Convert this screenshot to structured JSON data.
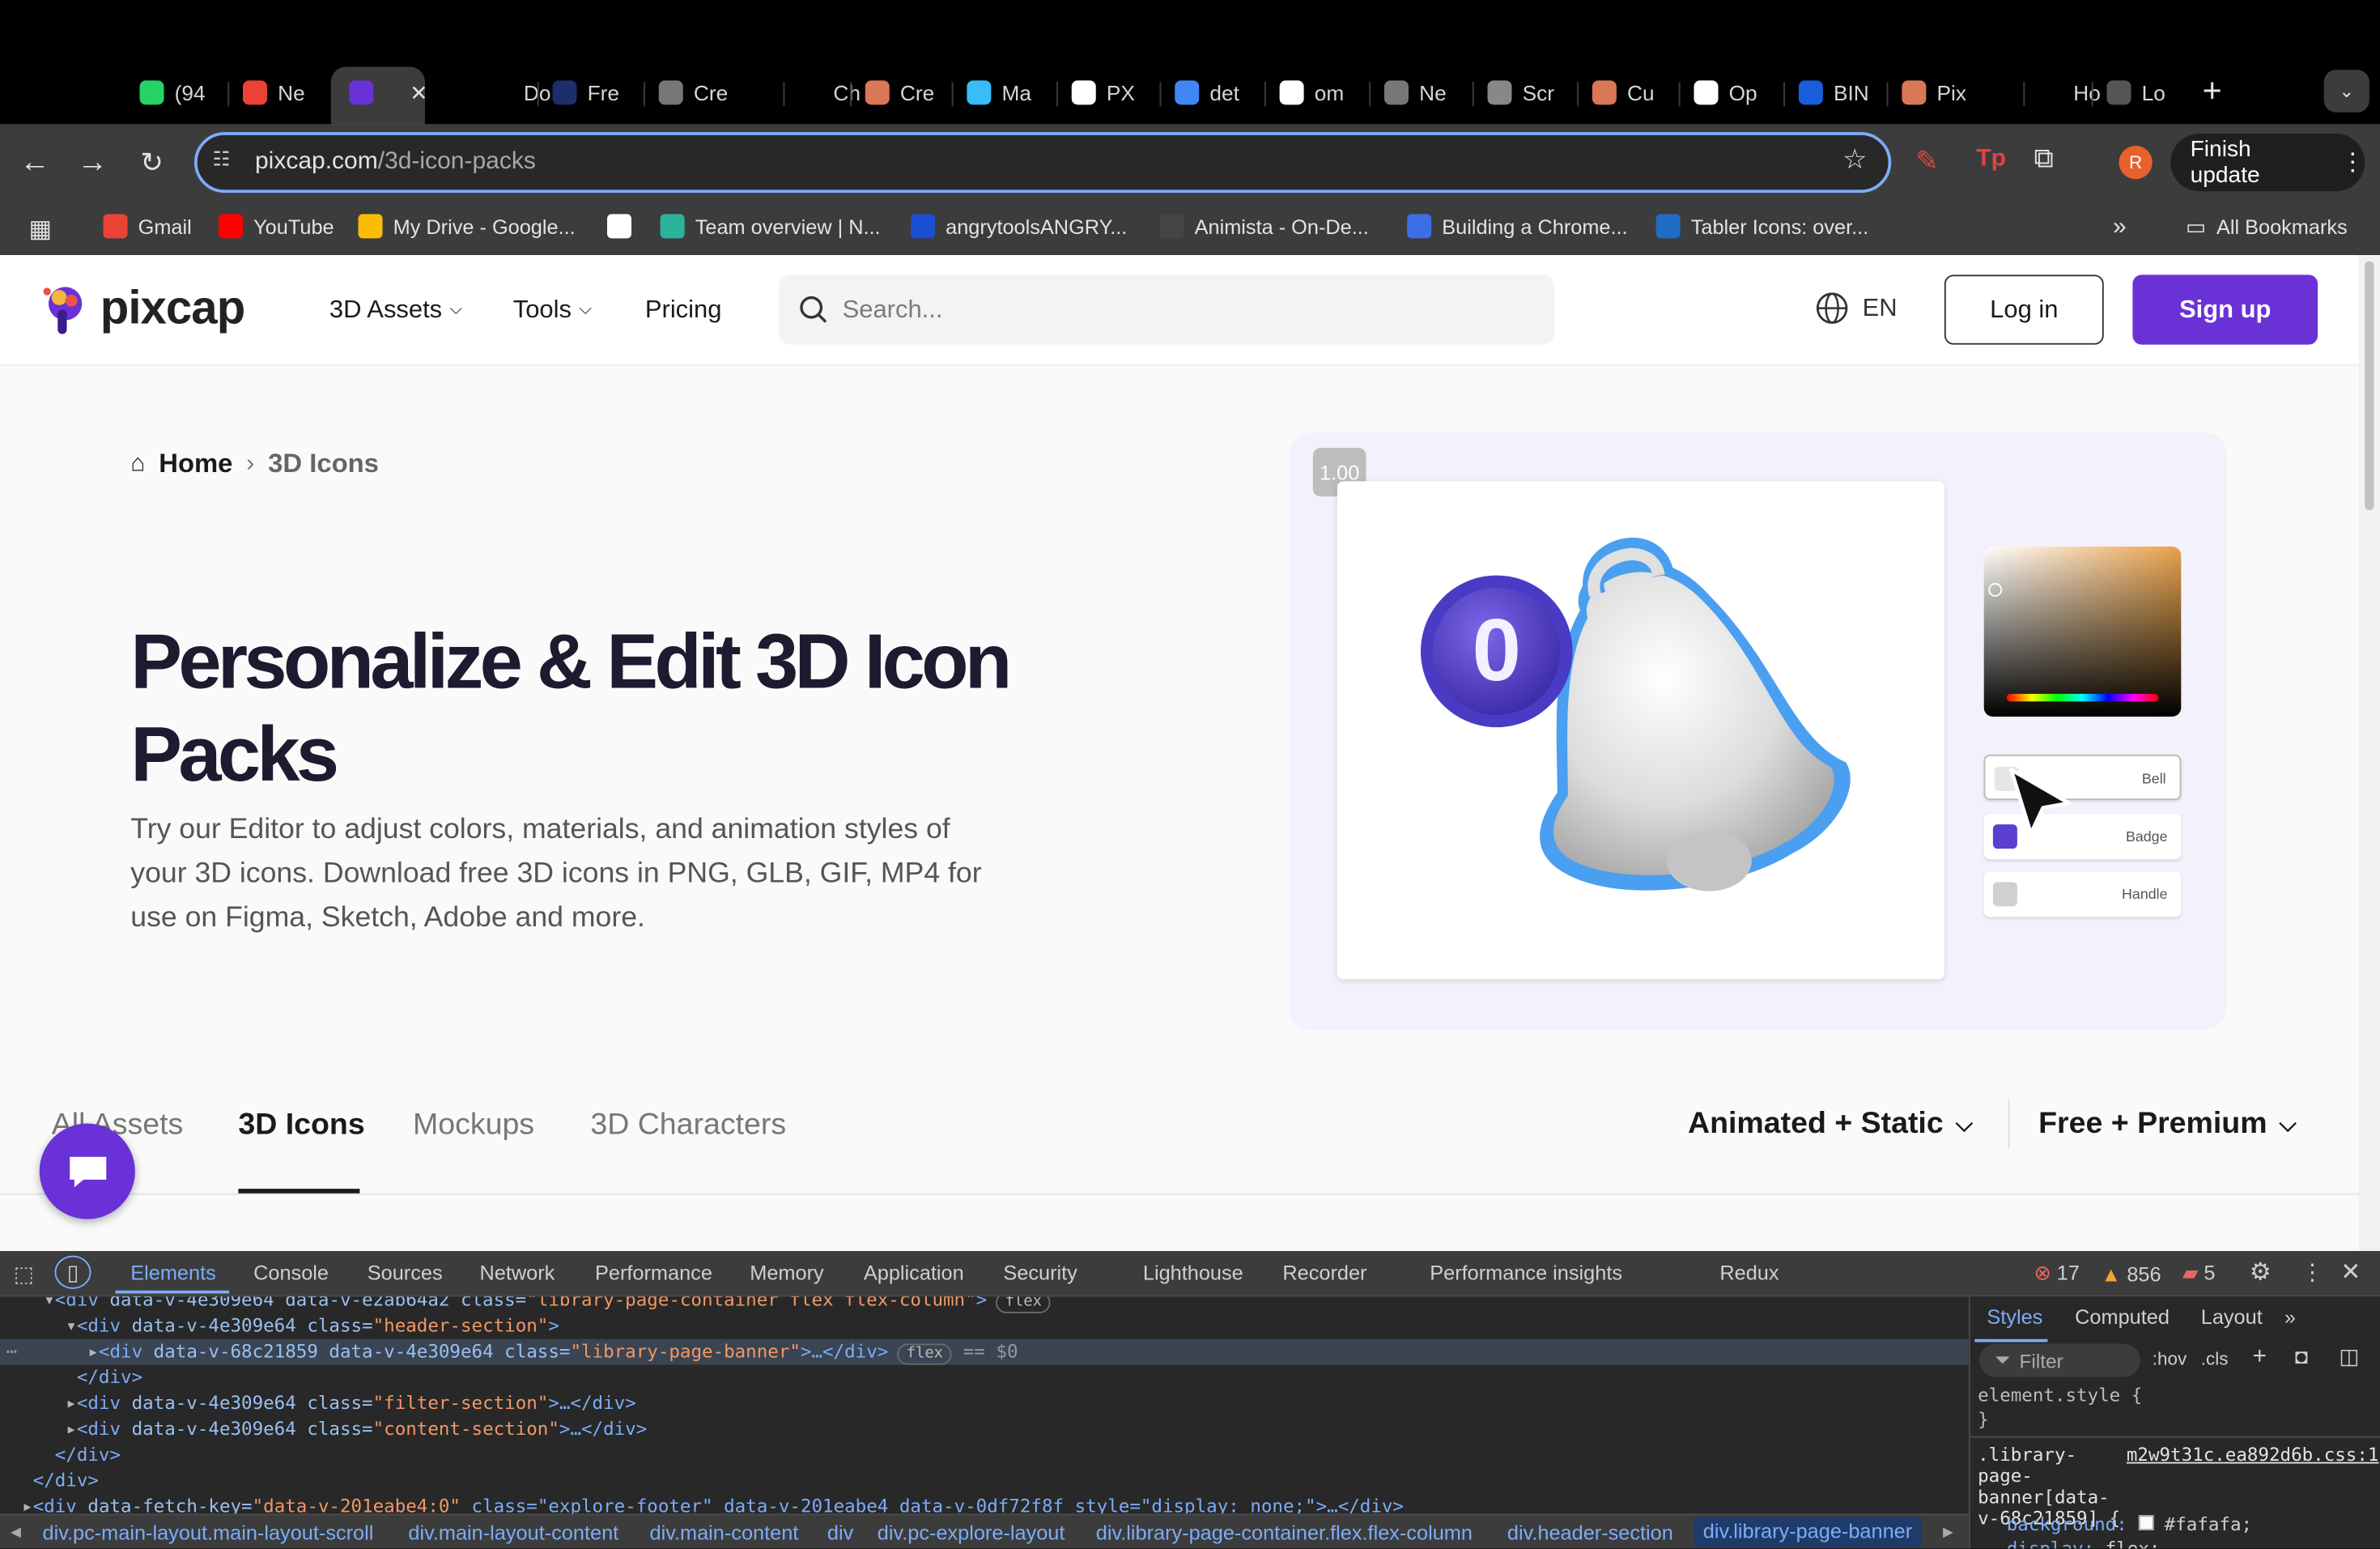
{
  "browser": {
    "tabs": [
      {
        "label": "(94",
        "icon": "whatsapp-icon",
        "color": "#25d366"
      },
      {
        "label": "Ne",
        "icon": "gmail-icon",
        "color": "#ea4335"
      },
      {
        "label": "",
        "icon": "pixcap-icon",
        "color": "#6a32d6",
        "active": true
      },
      {
        "label": "Do",
        "icon": "doc-icon",
        "color": "#000000"
      },
      {
        "label": "Fre",
        "icon": "mgl-icon",
        "color": "#1c2e6b"
      },
      {
        "label": "Cre",
        "icon": "openai-icon",
        "color": "#777777"
      },
      {
        "label": "Ch",
        "icon": "chatgpt-icon",
        "color": "#000000"
      },
      {
        "label": "Cre",
        "icon": "claude-icon",
        "color": "#d97757"
      },
      {
        "label": "Ma",
        "icon": "tailwind-icon",
        "color": "#38bdf8"
      },
      {
        "label": "PX",
        "icon": "px-icon",
        "color": "#ffffff"
      },
      {
        "label": "det",
        "icon": "google-icon",
        "color": "#4285f4"
      },
      {
        "label": "om",
        "icon": "github-icon",
        "color": "#ffffff"
      },
      {
        "label": "Ne",
        "icon": "openai-icon",
        "color": "#777777"
      },
      {
        "label": "Scr",
        "icon": "globe-icon",
        "color": "#888888"
      },
      {
        "label": "Cu",
        "icon": "claude-icon",
        "color": "#d97757"
      },
      {
        "label": "Op",
        "icon": "op-icon",
        "color": "#ffffff"
      },
      {
        "label": "BIN",
        "icon": "bitwarden-icon",
        "color": "#175ddc"
      },
      {
        "label": "Pix",
        "icon": "claude-icon",
        "color": "#d97757"
      },
      {
        "label": "Ho",
        "icon": "blank-icon",
        "color": "#000000"
      },
      {
        "label": "Lo",
        "icon": "cloud-icon",
        "color": "#555555"
      }
    ],
    "url_host": "pixcap.com",
    "url_path": "/3d-icon-packs",
    "profile_initial": "R",
    "finish_update": "Finish update",
    "bookmarks": [
      {
        "label": "Gmail",
        "icon": "gmail-icon",
        "color": "#ea4335"
      },
      {
        "label": "YouTube",
        "icon": "youtube-icon",
        "color": "#ff0000"
      },
      {
        "label": "My Drive - Google...",
        "icon": "drive-icon",
        "color": "#fbbc04"
      },
      {
        "label": "",
        "icon": "github-icon",
        "color": "#ffffff"
      },
      {
        "label": "Team overview | N...",
        "icon": "diamond-icon",
        "color": "#2bb39b"
      },
      {
        "label": "angrytoolsANGRY...",
        "icon": "angrytools-icon",
        "color": "#1a4fd1"
      },
      {
        "label": "Animista - On-De...",
        "icon": "animista-icon",
        "color": "#444444"
      },
      {
        "label": "Building a Chrome...",
        "icon": "co-icon",
        "color": "#3b6ee6"
      },
      {
        "label": "Tabler Icons: over...",
        "icon": "tabler-icon",
        "color": "#206bc4"
      }
    ],
    "all_bookmarks": "All Bookmarks"
  },
  "site": {
    "logo": "pixcap",
    "nav": {
      "assets": "3D Assets",
      "tools": "Tools",
      "pricing": "Pricing"
    },
    "search_placeholder": "Search...",
    "lang": "EN",
    "login": "Log in",
    "signup": "Sign up"
  },
  "breadcrumb": {
    "home": "Home",
    "current": "3D Icons"
  },
  "hero": {
    "title": "Personalize & Edit 3D Icon Packs",
    "subtitle": "Try our Editor to adjust colors, materials, and animation styles of your 3D icons. Download free 3D icons in PNG, GLB, GIF, MP4 for use on Figma, Sketch, Adobe and more."
  },
  "preview": {
    "zoom": "1.00",
    "badge_number": "0",
    "layers": [
      {
        "name": "Bell",
        "color": "#e6e6e6"
      },
      {
        "name": "Badge",
        "color": "#5b3fd1"
      },
      {
        "name": "Handle",
        "color": "#d0d0d0"
      }
    ]
  },
  "category_tabs": [
    {
      "label": "All Assets",
      "active": false
    },
    {
      "label": "3D Icons",
      "active": true
    },
    {
      "label": "Mockups",
      "active": false
    },
    {
      "label": "3D Characters",
      "active": false
    }
  ],
  "filters": {
    "animation": "Animated + Static",
    "price": "Free + Premium"
  },
  "devtools": {
    "tabs": [
      "Elements",
      "Console",
      "Sources",
      "Network",
      "Performance",
      "Memory",
      "Application",
      "Security",
      "Lighthouse",
      "Recorder",
      "Performance insights",
      "Redux"
    ],
    "errors": "17",
    "warnings": "856",
    "issues": "5",
    "code_lines": [
      {
        "indent": "    ▾",
        "tag": "<div",
        "attrs": " data-v-4e309e64 data-v-e2ab64a2 class=",
        "val": "\"library-page-container flex flex-column\"",
        "tail": ">",
        "badge": "flex"
      },
      {
        "indent": "      ▾",
        "tag": "<div",
        "attrs": " data-v-4e309e64 class=",
        "val": "\"header-section\"",
        "tail": ">",
        "badge": ""
      },
      {
        "indent": "        ▸",
        "tag": "<div",
        "attrs": " data-v-68c21859 data-v-4e309e64 class=",
        "val": "\"library-page-banner\"",
        "tail": ">…</div>",
        "badge": "flex",
        "selected": true,
        "suffix": " == $0"
      },
      {
        "indent": "       ",
        "tag": "</div>",
        "attrs": "",
        "val": "",
        "tail": "",
        "badge": ""
      },
      {
        "indent": "      ▸",
        "tag": "<div",
        "attrs": " data-v-4e309e64 class=",
        "val": "\"filter-section\"",
        "tail": ">…</div>",
        "badge": ""
      },
      {
        "indent": "      ▸",
        "tag": "<div",
        "attrs": " data-v-4e309e64 class=",
        "val": "\"content-section\"",
        "tail": ">…</div>",
        "badge": ""
      },
      {
        "indent": "     ",
        "tag": "</div>",
        "attrs": "",
        "val": "",
        "tail": "",
        "badge": ""
      },
      {
        "indent": "   ",
        "tag": "</div>",
        "attrs": "",
        "val": "",
        "tail": "",
        "badge": ""
      },
      {
        "indent": "  ▸",
        "tag": "<div",
        "attrs": " data-fetch-key=",
        "val": "\"data-v-201eabe4:0\"",
        "tail": " class=\"explore-footer\" data-v-201eabe4 data-v-0df72f8f style=\"display: none;\">…</div>",
        "badge": ""
      }
    ],
    "breadcrumbs": [
      "div.pc-main-layout.main-layout-scroll",
      "div.main-layout-content",
      "div.main-content",
      "div",
      "div.pc-explore-layout",
      "div.library-page-container.flex.flex-column",
      "div.header-section",
      "div.library-page-banner"
    ],
    "styles_tabs": [
      "Styles",
      "Computed",
      "Layout"
    ],
    "filter_placeholder": "Filter",
    "hov": ":hov",
    "cls": ".cls",
    "element_style": "element.style {",
    "close_brace": "}",
    "rule_selector": ".library-page-banner[data-v-68c21859] {",
    "rule_source": "m2w9t31c.ea892d6b.css:1",
    "rule_prop1": "background:",
    "rule_val1": "#fafafa;",
    "rule_prop2": "display:",
    "rule_val2": "flex;"
  }
}
